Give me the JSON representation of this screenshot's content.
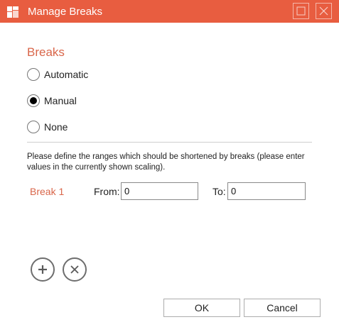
{
  "window": {
    "title": "Manage Breaks",
    "accent_color": "#e85d40",
    "icons": [
      "app-icon",
      "maximize-icon",
      "close-icon"
    ]
  },
  "breaks_section": {
    "title": "Breaks",
    "options": [
      {
        "label": "Automatic",
        "checked": false
      },
      {
        "label": "Manual",
        "checked": true
      },
      {
        "label": "None",
        "checked": false
      }
    ]
  },
  "description": "Please define the ranges which should be shortened by breaks (please enter values in the currently shown scaling).",
  "breaks": [
    {
      "label": "Break 1",
      "from_label": "From:",
      "from_value": "0",
      "to_label": "To:",
      "to_value": "0"
    }
  ],
  "actions": {
    "add_icon": "plus-icon",
    "remove_icon": "x-icon"
  },
  "buttons": {
    "ok": "OK",
    "cancel": "Cancel"
  }
}
